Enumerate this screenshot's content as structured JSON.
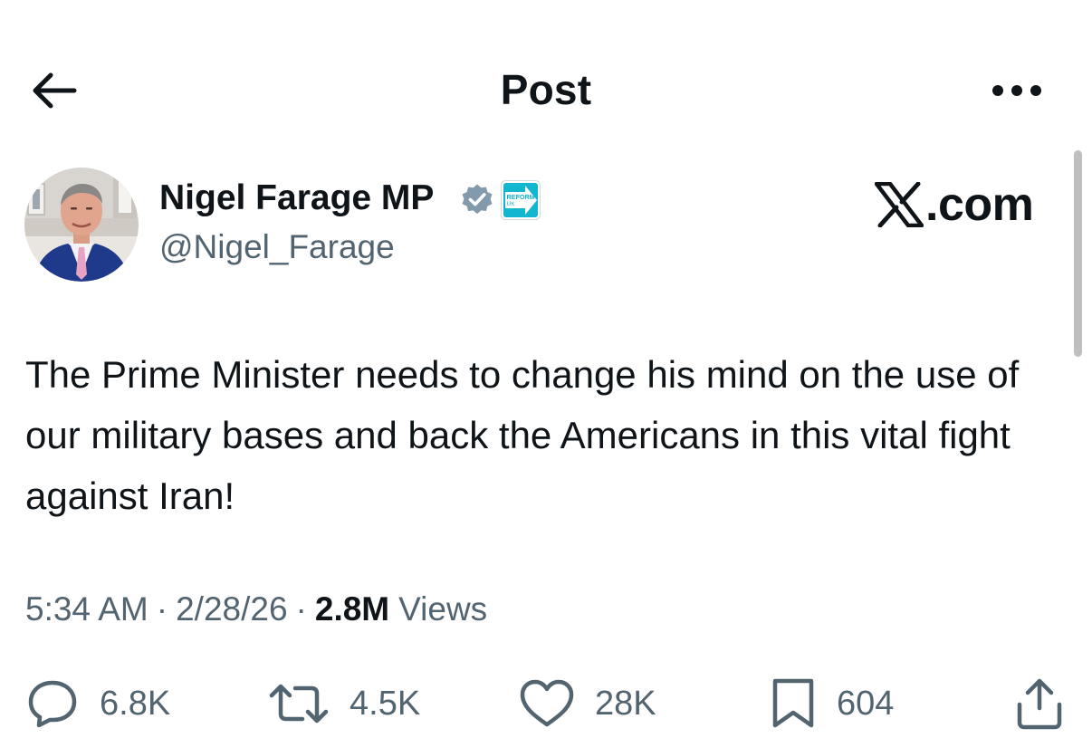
{
  "header": {
    "title": "Post",
    "back_icon": "arrow-left-icon",
    "more_icon": "more-horizontal-icon"
  },
  "author": {
    "display_name": "Nigel Farage MP",
    "handle": "@Nigel_Farage",
    "verified_icon": "verified-badge-icon",
    "verified_color": "#829aab",
    "affiliate_badge": {
      "text_line1": "REFORM",
      "text_line2": "UK",
      "color": "#12b6cf"
    }
  },
  "watermark": {
    "text": ".com",
    "logo_icon": "x-logo-icon"
  },
  "post": {
    "text": "The Prime Minister needs to change his mind on the use of our military bases and back the Americans in this vital fight against Iran!"
  },
  "meta": {
    "time": "5:34 AM",
    "separator": "·",
    "date": "2/28/26",
    "views_count": "2.8M",
    "views_label": "Views"
  },
  "actions": {
    "replies": {
      "count": "6.8K",
      "icon": "reply-icon"
    },
    "reposts": {
      "count": "4.5K",
      "icon": "repost-icon"
    },
    "likes": {
      "count": "28K",
      "icon": "heart-icon"
    },
    "bookmarks": {
      "count": "604",
      "icon": "bookmark-icon"
    },
    "share": {
      "icon": "share-icon"
    }
  },
  "colors": {
    "text_primary": "#0f1419",
    "text_secondary": "#536471",
    "background": "#ffffff"
  }
}
